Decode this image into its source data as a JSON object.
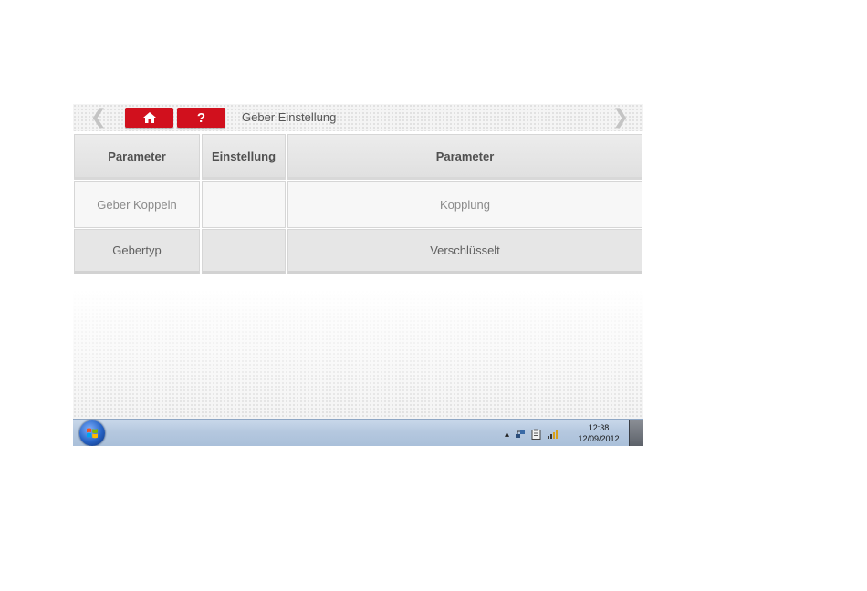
{
  "header": {
    "title": "Geber Einstellung",
    "help_label": "?",
    "back_icon": "chevron-left-icon",
    "forward_icon": "chevron-right-icon",
    "home_icon": "home-icon"
  },
  "table": {
    "columns": [
      "Parameter",
      "Einstellung",
      "Parameter"
    ],
    "rows": [
      [
        "Geber Koppeln",
        "",
        "Kopplung"
      ],
      [
        "Gebertyp",
        "",
        "Verschlüsselt"
      ]
    ]
  },
  "taskbar": {
    "time": "12:38",
    "date": "12/09/2012",
    "tray_icons": [
      "tray-arrow-icon",
      "network-icon",
      "clipboard-icon",
      "signal-icon"
    ]
  },
  "colors": {
    "accent_red": "#d1101d",
    "taskbar_blue": "#b5c8df"
  }
}
